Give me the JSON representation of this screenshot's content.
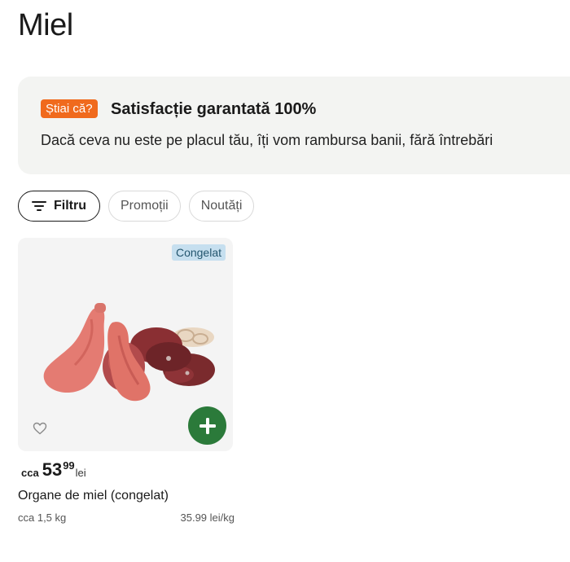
{
  "page": {
    "title": "Miel"
  },
  "banner": {
    "badge": "Știai că?",
    "title": "Satisfacție garantată 100%",
    "text": "Dacă ceva nu este pe placul tău, îți vom rambursa banii, fără întrebări"
  },
  "filters": [
    {
      "label": "Filtru",
      "icon": "filter-icon"
    },
    {
      "label": "Promoții"
    },
    {
      "label": "Noutăți"
    }
  ],
  "products": [
    {
      "tag": "Congelat",
      "price_prefix": "cca",
      "price_int": "53",
      "price_dec": "99",
      "currency": "lei",
      "name": "Organe de miel (congelat)",
      "quantity": "cca 1,5 kg",
      "unit_price": "35.99 lei/kg",
      "icons": {
        "favorite": "heart-icon",
        "add": "plus-icon"
      }
    }
  ],
  "colors": {
    "badge": "#f06a1d",
    "banner_bg": "#f3f4f2",
    "tag_bg": "#c6dfef",
    "add_button": "#2b7a3a"
  }
}
